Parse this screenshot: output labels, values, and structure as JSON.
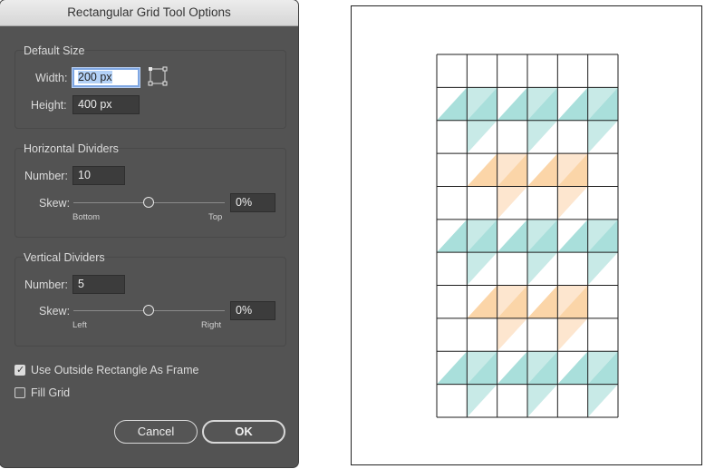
{
  "dialog": {
    "title": "Rectangular Grid Tool Options",
    "default_size": {
      "title": "Default Size",
      "width_label": "Width:",
      "width_value": "200 px",
      "height_label": "Height:",
      "height_value": "400 px"
    },
    "horizontal": {
      "title": "Horizontal Dividers",
      "number_label": "Number:",
      "number_value": "10",
      "skew_label": "Skew:",
      "skew_value": "0%",
      "min_label": "Bottom",
      "max_label": "Top"
    },
    "vertical": {
      "title": "Vertical Dividers",
      "number_label": "Number:",
      "number_value": "5",
      "skew_label": "Skew:",
      "skew_value": "0%",
      "min_label": "Left",
      "max_label": "Right"
    },
    "use_frame_label": "Use Outside Rectangle As Frame",
    "use_frame_checked": true,
    "fill_grid_label": "Fill Grid",
    "fill_grid_checked": false,
    "cancel_label": "Cancel",
    "ok_label": "OK"
  },
  "artwork": {
    "columns": 6,
    "rows": 11,
    "colors": {
      "teal": "#a9dfdb",
      "teal_light": "#c8eae7",
      "orange": "#fbd5a8",
      "orange_light": "#fde6cf",
      "line": "#1e1e1e"
    }
  }
}
